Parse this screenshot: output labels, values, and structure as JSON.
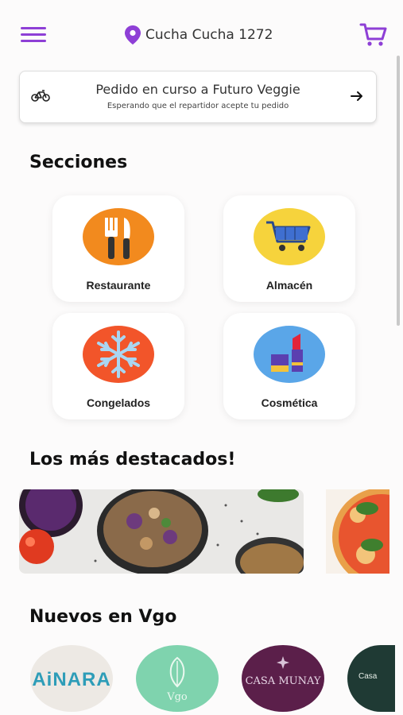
{
  "header": {
    "location": "Cucha Cucha 1272",
    "menu_icon": "hamburger-menu-icon",
    "cart_icon": "shopping-cart-icon",
    "accent": "#8e3fd6"
  },
  "order": {
    "title": "Pedido en curso a Futuro Veggie",
    "subtitle": "Esperando que el repartidor acepte tu pedido"
  },
  "sections": {
    "heading": "Secciones",
    "items": [
      {
        "label": "Restaurante",
        "icon": "fork-knife-icon"
      },
      {
        "label": "Almacén",
        "icon": "shopping-cart-icon"
      },
      {
        "label": "Congelados",
        "icon": "snowflake-icon"
      },
      {
        "label": "Cosmética",
        "icon": "lipstick-icon"
      }
    ]
  },
  "featured": {
    "heading": "Los más destacados!"
  },
  "new_stores": {
    "heading": "Nuevos en Vgo",
    "items": [
      {
        "name": "AiNARA"
      },
      {
        "name": "Vgo"
      },
      {
        "name": "CASA MUNAY"
      },
      {
        "name": "Casa"
      }
    ]
  }
}
